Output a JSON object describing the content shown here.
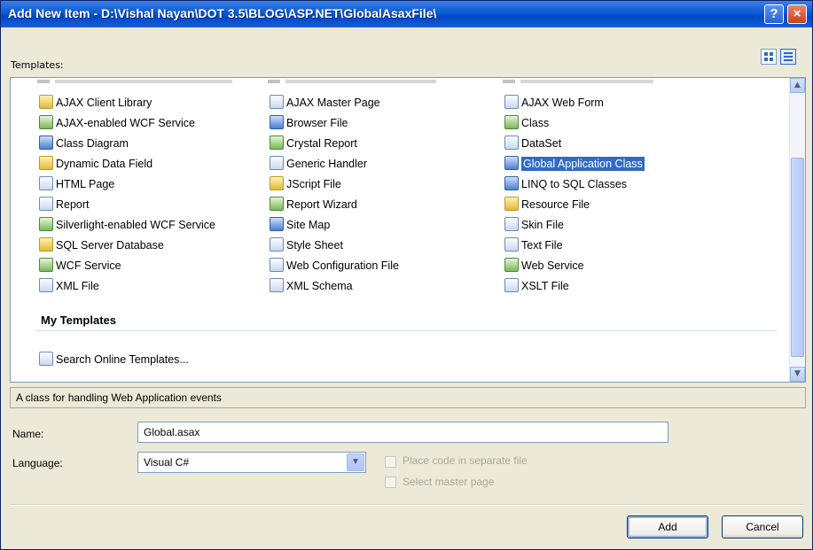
{
  "window": {
    "title": "Add New Item - D:\\Vishal Nayan\\DOT 3.5\\BLOG\\ASP.NET\\GlobalAsaxFile\\",
    "help_label": "?",
    "close_label": "×"
  },
  "templates": {
    "label": "Templates:",
    "col1": [
      {
        "label": "AJAX Client Library",
        "icon": "ajax-library-icon"
      },
      {
        "label": "AJAX-enabled WCF Service",
        "icon": "wcf-service-icon"
      },
      {
        "label": "Class Diagram",
        "icon": "class-diagram-icon"
      },
      {
        "label": "Dynamic Data Field",
        "icon": "dynamic-data-icon"
      },
      {
        "label": "HTML Page",
        "icon": "html-page-icon"
      },
      {
        "label": "Report",
        "icon": "report-icon"
      },
      {
        "label": "Silverlight-enabled WCF Service",
        "icon": "wcf-service-icon"
      },
      {
        "label": "SQL Server Database",
        "icon": "database-icon"
      },
      {
        "label": "WCF Service",
        "icon": "wcf-service-icon"
      },
      {
        "label": "XML File",
        "icon": "xml-file-icon"
      }
    ],
    "col2": [
      {
        "label": "AJAX Master Page",
        "icon": "master-page-icon"
      },
      {
        "label": "Browser File",
        "icon": "browser-file-icon"
      },
      {
        "label": "Crystal Report",
        "icon": "crystal-report-icon"
      },
      {
        "label": "Generic Handler",
        "icon": "generic-handler-icon"
      },
      {
        "label": "JScript File",
        "icon": "jscript-file-icon"
      },
      {
        "label": "Report Wizard",
        "icon": "report-wizard-icon"
      },
      {
        "label": "Site Map",
        "icon": "site-map-icon"
      },
      {
        "label": "Style Sheet",
        "icon": "style-sheet-icon"
      },
      {
        "label": "Web Configuration File",
        "icon": "web-config-icon"
      },
      {
        "label": "XML Schema",
        "icon": "xml-schema-icon"
      }
    ],
    "col3": [
      {
        "label": "AJAX Web Form",
        "icon": "web-form-icon"
      },
      {
        "label": "Class",
        "icon": "class-icon"
      },
      {
        "label": "DataSet",
        "icon": "dataset-icon"
      },
      {
        "label": "Global Application Class",
        "icon": "global-app-icon",
        "selected": true
      },
      {
        "label": "LINQ to SQL Classes",
        "icon": "linq-icon"
      },
      {
        "label": "Resource File",
        "icon": "resource-file-icon"
      },
      {
        "label": "Skin File",
        "icon": "skin-file-icon"
      },
      {
        "label": "Text File",
        "icon": "text-file-icon"
      },
      {
        "label": "Web Service",
        "icon": "web-service-icon"
      },
      {
        "label": "XSLT File",
        "icon": "xslt-file-icon"
      }
    ],
    "my_templates_heading": "My Templates",
    "search_online": "Search Online Templates..."
  },
  "description": "A class for handling Web Application events",
  "form": {
    "name_label": "Name:",
    "name_value": "Global.asax",
    "language_label": "Language:",
    "language_value": "Visual C#",
    "place_code_label": "Place code in separate file",
    "select_master_label": "Select master page"
  },
  "buttons": {
    "add": "Add",
    "cancel": "Cancel"
  }
}
